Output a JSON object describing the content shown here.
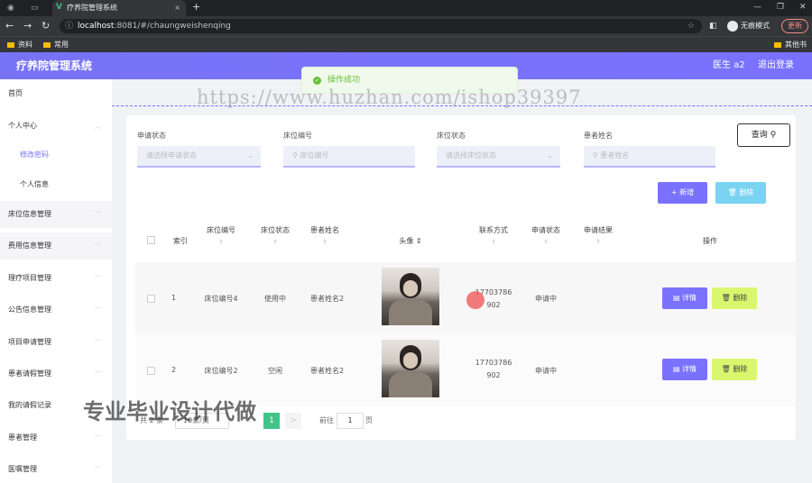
{
  "browser": {
    "tab_title": "疗养院管理系统",
    "tab_logo": "V",
    "new_tab": "+",
    "url_host": "localhost",
    "url_rest": ":8081/#/chaungweishenqing",
    "profile_label": "无痕模式",
    "update_label": "更新",
    "bookmarks": [
      "资料",
      "常用",
      "其他书签"
    ]
  },
  "header": {
    "system_title": "疗养院管理系统",
    "user_label": "医生 a2",
    "logout_label": "退出登录"
  },
  "toast": {
    "message": "操作成功"
  },
  "sidebar": {
    "items": [
      {
        "label": "首页"
      },
      {
        "label": "个人中心"
      },
      {
        "label": "修改密码"
      },
      {
        "label": "个人信息"
      },
      {
        "label": "床位信息管理"
      },
      {
        "label": "费用信息管理"
      },
      {
        "label": "理疗项目管理"
      },
      {
        "label": "公告信息管理"
      },
      {
        "label": "项目申请管理"
      },
      {
        "label": "患者请假管理"
      },
      {
        "label": "我的请假记录"
      },
      {
        "label": "患者管理"
      },
      {
        "label": "医嘱管理"
      }
    ]
  },
  "filters": {
    "status_label": "申请状态",
    "status_placeholder": "请选择申请状态",
    "bed_no_label": "床位编号",
    "bed_no_placeholder": "床位编号",
    "bed_status_label": "床位状态",
    "bed_status_placeholder": "请选择床位状态",
    "patient_label": "患者姓名",
    "patient_placeholder": "患者姓名",
    "query_label": "查询"
  },
  "actions": {
    "add_label": "新增",
    "delete_label": "删除"
  },
  "table": {
    "headers": [
      "索引",
      "床位编号",
      "床位状态",
      "患者姓名",
      "头像",
      "联系方式",
      "申请状态",
      "申请结果",
      "操作"
    ],
    "sort_icon": "⇕",
    "rows": [
      {
        "index": "1",
        "bed_no": "床位编号4",
        "bed_status": "使用中",
        "patient": "患者姓名2",
        "phone_a": "17703786",
        "phone_b": "902",
        "apply_status": "申请中",
        "apply_result": "",
        "detail": "详情",
        "delete": "删除"
      },
      {
        "index": "2",
        "bed_no": "床位编号2",
        "bed_status": "空闲",
        "patient": "患者姓名2",
        "phone_a": "17703786",
        "phone_b": "902",
        "apply_status": "申请中",
        "apply_result": "",
        "detail": "详情",
        "delete": "删除"
      }
    ]
  },
  "pagination": {
    "total": "共 2 条",
    "page_size": "10条/页",
    "current": "1",
    "prev": "<",
    "next": ">",
    "goto_label": "前往",
    "goto_value": "1",
    "page_unit": "页"
  },
  "watermarks": {
    "url": "https://www.huzhan.com/ishop39397",
    "promo": "专业毕业设计代做"
  },
  "colors": {
    "accent": "#7a72ff",
    "success": "#67c23a",
    "delete_btn": "#d9f76e",
    "batch_delete": "#79d3f1",
    "page_current": "#41c38a"
  }
}
